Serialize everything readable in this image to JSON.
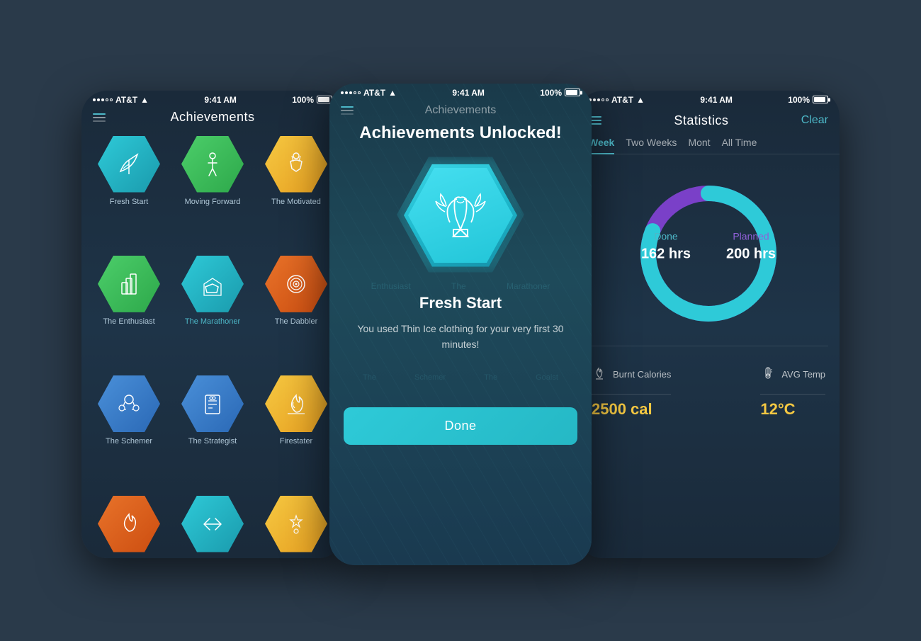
{
  "phones": {
    "left": {
      "status": {
        "carrier": "AT&T",
        "time": "9:41 AM",
        "battery": "100%"
      },
      "title": "Achievements",
      "badges": [
        {
          "id": "fresh-start",
          "label": "Fresh Start",
          "color": "hex-teal",
          "icon": "🦋"
        },
        {
          "id": "moving-forward",
          "label": "Moving Forward",
          "color": "hex-green",
          "icon": "🏃"
        },
        {
          "id": "the-motivated",
          "label": "The Motivated",
          "color": "hex-yellow",
          "icon": "🙌"
        },
        {
          "id": "the-enthusiast",
          "label": "The Enthusiast",
          "color": "hex-green",
          "icon": "🏆"
        },
        {
          "id": "the-marathoner",
          "label": "The Marathoner",
          "color": "hex-teal",
          "icon": "⬡"
        },
        {
          "id": "the-dabbler",
          "label": "The Dabbler",
          "color": "hex-orange",
          "icon": "🎯"
        },
        {
          "id": "the-schemer",
          "label": "The Schemer",
          "color": "hex-blue",
          "icon": "🤖"
        },
        {
          "id": "the-strategist",
          "label": "The Strategist",
          "color": "hex-blue",
          "icon": "📋"
        },
        {
          "id": "firestater",
          "label": "Firestater",
          "color": "hex-yellow",
          "icon": "🔥"
        },
        {
          "id": "partial-1",
          "label": "",
          "color": "hex-orange",
          "icon": "🔥"
        },
        {
          "id": "partial-2",
          "label": "",
          "color": "hex-teal",
          "icon": "↔"
        },
        {
          "id": "partial-3",
          "label": "",
          "color": "hex-yellow",
          "icon": "✨"
        }
      ]
    },
    "center": {
      "status": {
        "carrier": "AT&T",
        "time": "9:41 AM",
        "battery": "100%"
      },
      "header_title": "Achievements",
      "unlocked_title": "Achievements Unlocked!",
      "badge_icon": "🦶",
      "achievement_name": "Fresh Start",
      "achievement_desc": "You used Thin Ice clothing for your very first 30 minutes!",
      "done_button": "Done",
      "bg_texts": [
        "Enthusiast",
        "The",
        "Marathoner",
        "Goalst"
      ]
    },
    "right": {
      "status": {
        "carrier": "AT&T",
        "time": "9:41 AM",
        "battery": "100%"
      },
      "title": "Statistics",
      "clear_label": "Clear",
      "tabs": [
        {
          "id": "week",
          "label": "Week",
          "active": true
        },
        {
          "id": "two-weeks",
          "label": "Two Weeks",
          "active": false
        },
        {
          "id": "month",
          "label": "Mont",
          "active": false
        },
        {
          "id": "all-time",
          "label": "All Time",
          "active": false
        }
      ],
      "chart": {
        "done_label": "Done",
        "planned_label": "Planned",
        "done_value": "162 hrs",
        "planned_value": "200 hrs",
        "done_percent": 81
      },
      "stats": [
        {
          "icon": "🔥",
          "label": "Burnt Calories",
          "value": "2500 cal"
        },
        {
          "icon": "🌡",
          "label": "AVG Temp",
          "value": "12°C"
        }
      ]
    }
  }
}
